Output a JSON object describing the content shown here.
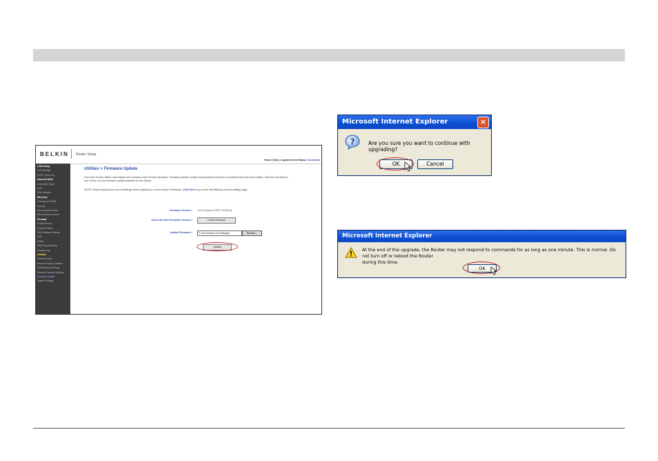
{
  "router": {
    "logo": "BELKIN",
    "app_title": "Router Setup",
    "top_links": "Home | Help | Logout   Internet Status: ",
    "connection_status": "Connected",
    "sidebar": [
      {
        "label": "LAN Setup",
        "style": "h"
      },
      {
        "label": "LAN Settings",
        "style": "s"
      },
      {
        "label": "DHCP Client List",
        "style": "s"
      },
      {
        "label": "Internet WAN",
        "style": "h"
      },
      {
        "label": "Connection Type",
        "style": "s"
      },
      {
        "label": "DNS",
        "style": "s"
      },
      {
        "label": "MAC Address",
        "style": "s"
      },
      {
        "label": "Wireless",
        "style": "h"
      },
      {
        "label": "Channel and SSID",
        "style": "s"
      },
      {
        "label": "Security",
        "style": "s"
      },
      {
        "label": "Use as Access Point",
        "style": "s"
      },
      {
        "label": "MAC Address Control",
        "style": "s"
      },
      {
        "label": "Firewall",
        "style": "h"
      },
      {
        "label": "Virtual Servers",
        "style": "s"
      },
      {
        "label": "Client IP Filters",
        "style": "s"
      },
      {
        "label": "MAC Address Filtering",
        "style": "s"
      },
      {
        "label": "DMZ",
        "style": "s"
      },
      {
        "label": "DDNS",
        "style": "s"
      },
      {
        "label": "WAN Ping Blocking",
        "style": "s"
      },
      {
        "label": "Security Log",
        "style": "s"
      },
      {
        "label": "Utilities",
        "style": "y"
      },
      {
        "label": "Restart Router",
        "style": "s"
      },
      {
        "label": "Restore Factory Defaults",
        "style": "s"
      },
      {
        "label": "Save/Backup Settings",
        "style": "s"
      },
      {
        "label": "Restore Previous Settings",
        "style": "s"
      },
      {
        "label": "Firmware Update",
        "style": "a"
      },
      {
        "label": "System Settings",
        "style": "s"
      }
    ],
    "page_title": "Utilities > Firmware Update",
    "intro": "From time to time, Belkin may release new versions of the Router's firmware. Firmware updates contain improvements and fixes to problems that may have existed. Click the link below to see if there is a new firmware update available for this Router.",
    "note_prefix": "NOTE: Please backup your current settings before updating to a new version of firmware.",
    "note_link": "Click Here",
    "note_suffix": "to go to the Save/Backup current settings page.",
    "firmware_version_label": "Firmware Version >",
    "firmware_version_value": "4.01.13 (Apr 14 2007 10:29:14)",
    "check_label": "Check the New Firmware Version >",
    "check_button": "Check Firmware",
    "update_label": "Update Firmware >",
    "file_path": "C:\\Documents and Settings\\",
    "browse_button": "Browse...",
    "update_button": "Update"
  },
  "dialog1": {
    "title": "Microsoft Internet Explorer",
    "message": "Are you sure you want to continue with upgrading?",
    "ok": "OK",
    "cancel": "Cancel"
  },
  "dialog2": {
    "title": "Microsoft Internet Explorer",
    "message_line1": "At the end of the upgrade, the Router may not respond to commands for as long as one minute. This is normal. Do not turn off or reboot the Router",
    "message_line2": "during this time.",
    "ok": "OK"
  },
  "icons": {
    "question": "question-icon",
    "warning": "warning-icon",
    "close": "close-icon",
    "cursor": "mouse-cursor-icon"
  },
  "colors": {
    "highlight_ring": "#c0202a",
    "title_bar": "#0a4fd0",
    "belkin_link": "#2a4aa8"
  }
}
